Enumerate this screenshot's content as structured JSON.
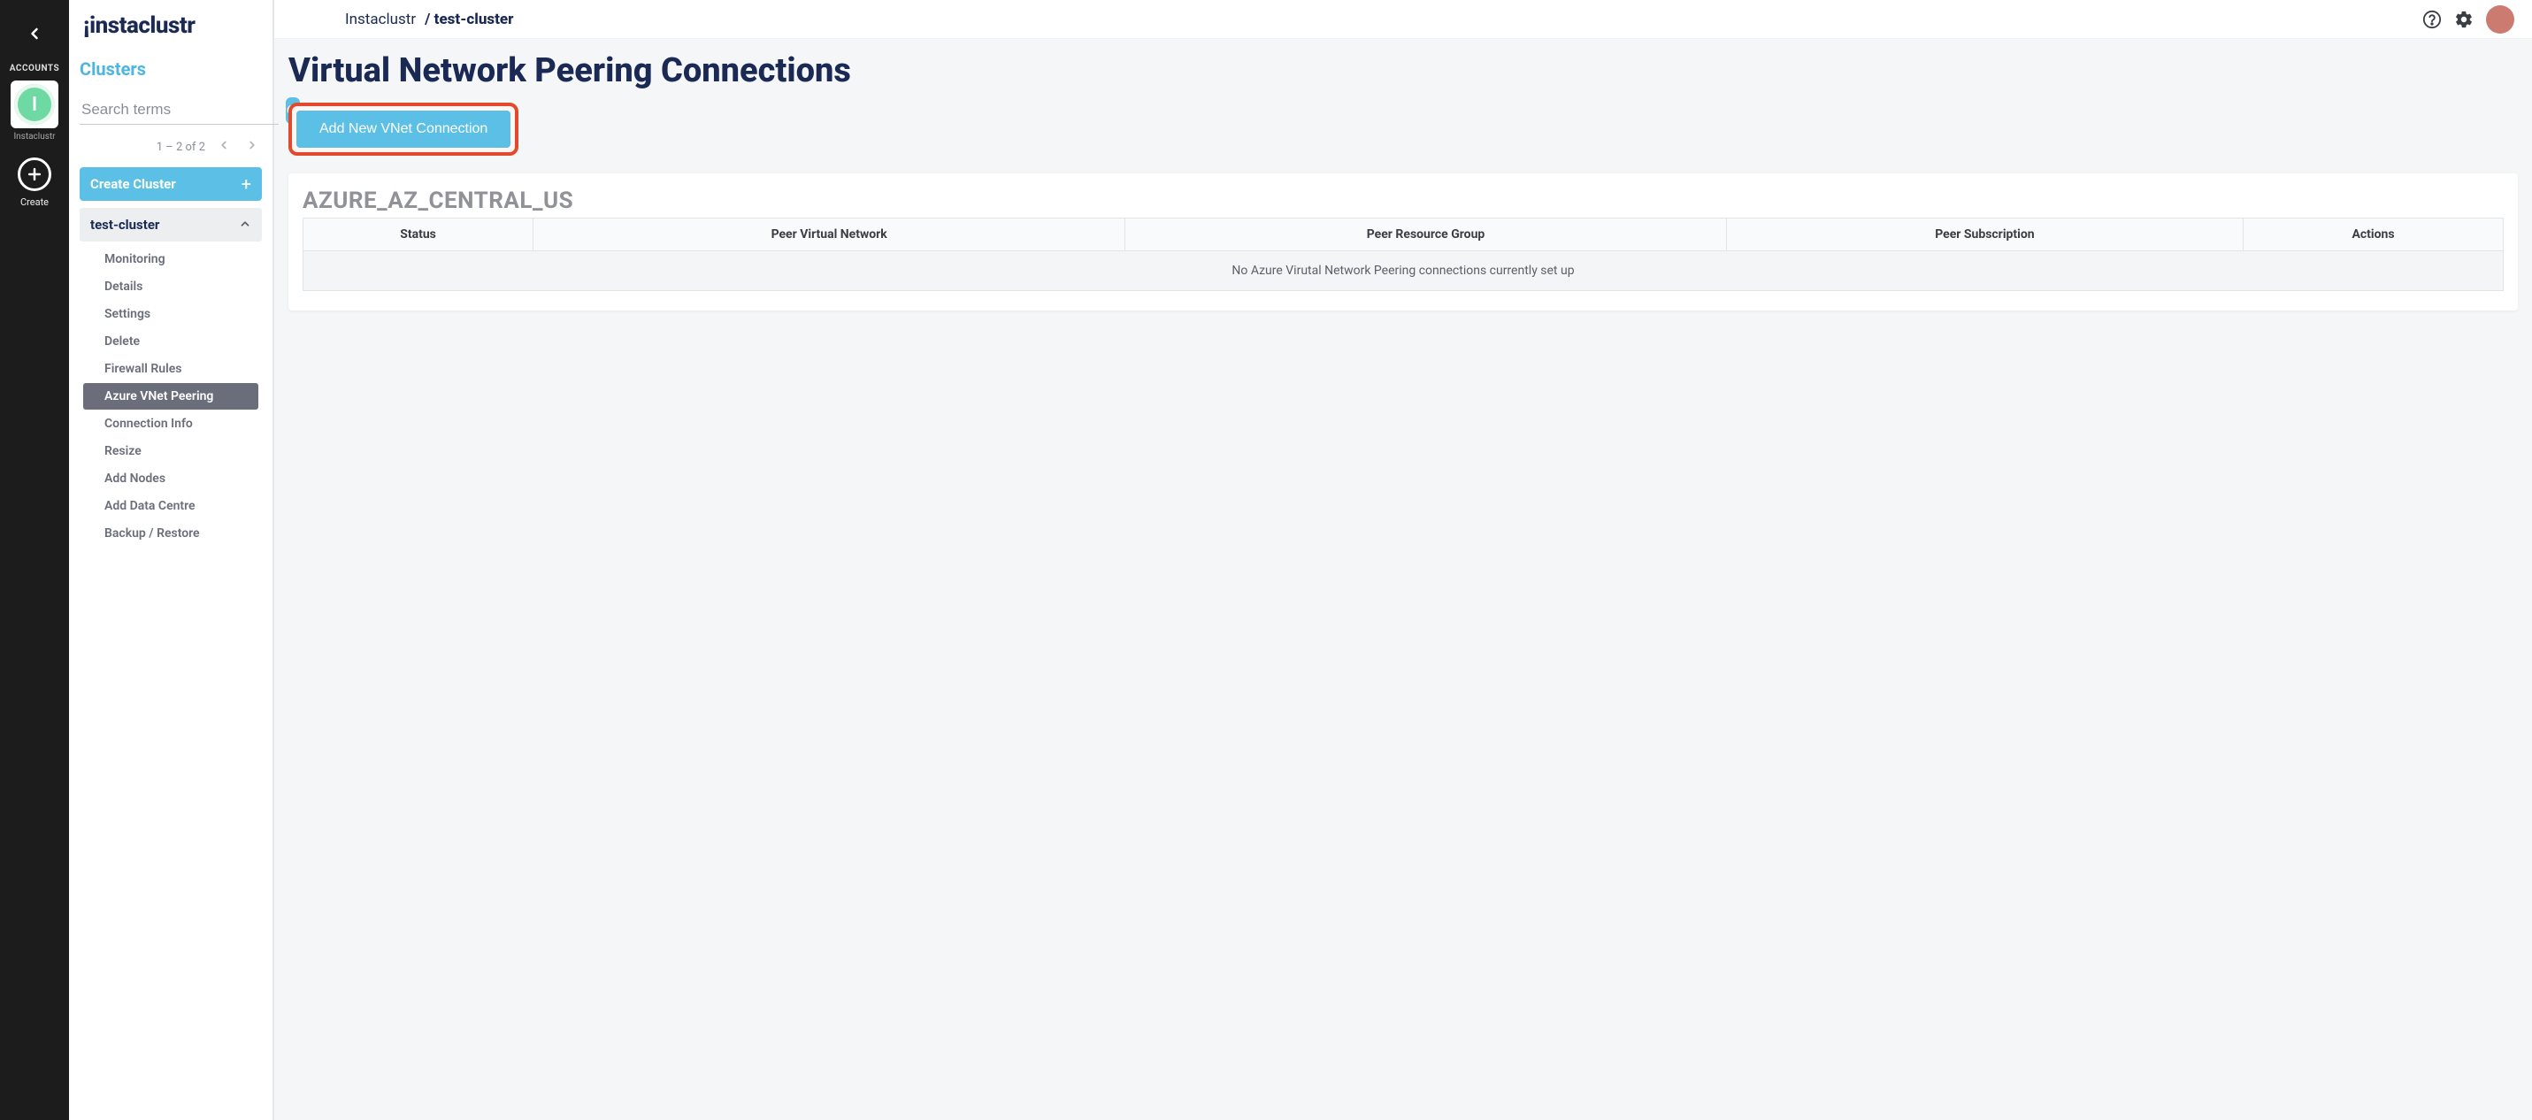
{
  "rail": {
    "accounts_label": "ACCOUNTS",
    "account_initial": "I",
    "account_name": "Instaclustr",
    "create_label": "Create"
  },
  "brand": "instaclustr",
  "sidebar": {
    "title": "Clusters",
    "search_placeholder": "Search terms",
    "pager_text": "1 – 2 of 2",
    "create_cluster_label": "Create Cluster",
    "cluster_name": "test-cluster",
    "nav": [
      {
        "label": "Monitoring",
        "active": false
      },
      {
        "label": "Details",
        "active": false
      },
      {
        "label": "Settings",
        "active": false
      },
      {
        "label": "Delete",
        "active": false
      },
      {
        "label": "Firewall Rules",
        "active": false
      },
      {
        "label": "Azure VNet Peering",
        "active": true
      },
      {
        "label": "Connection Info",
        "active": false
      },
      {
        "label": "Resize",
        "active": false
      },
      {
        "label": "Add Nodes",
        "active": false
      },
      {
        "label": "Add Data Centre",
        "active": false
      },
      {
        "label": "Backup / Restore",
        "active": false
      }
    ]
  },
  "breadcrumb": {
    "brand": "Instaclustr",
    "sep": "/",
    "current": "test-cluster"
  },
  "page": {
    "title": "Virtual Network Peering Connections",
    "add_button_label": "Add New VNet Connection",
    "region": "AZURE_AZ_CENTRAL_US",
    "table": {
      "columns": [
        "Status",
        "Peer Virtual Network",
        "Peer Resource Group",
        "Peer Subscription",
        "Actions"
      ],
      "empty_message": "No Azure Virutal Network Peering connections currently set up"
    }
  }
}
